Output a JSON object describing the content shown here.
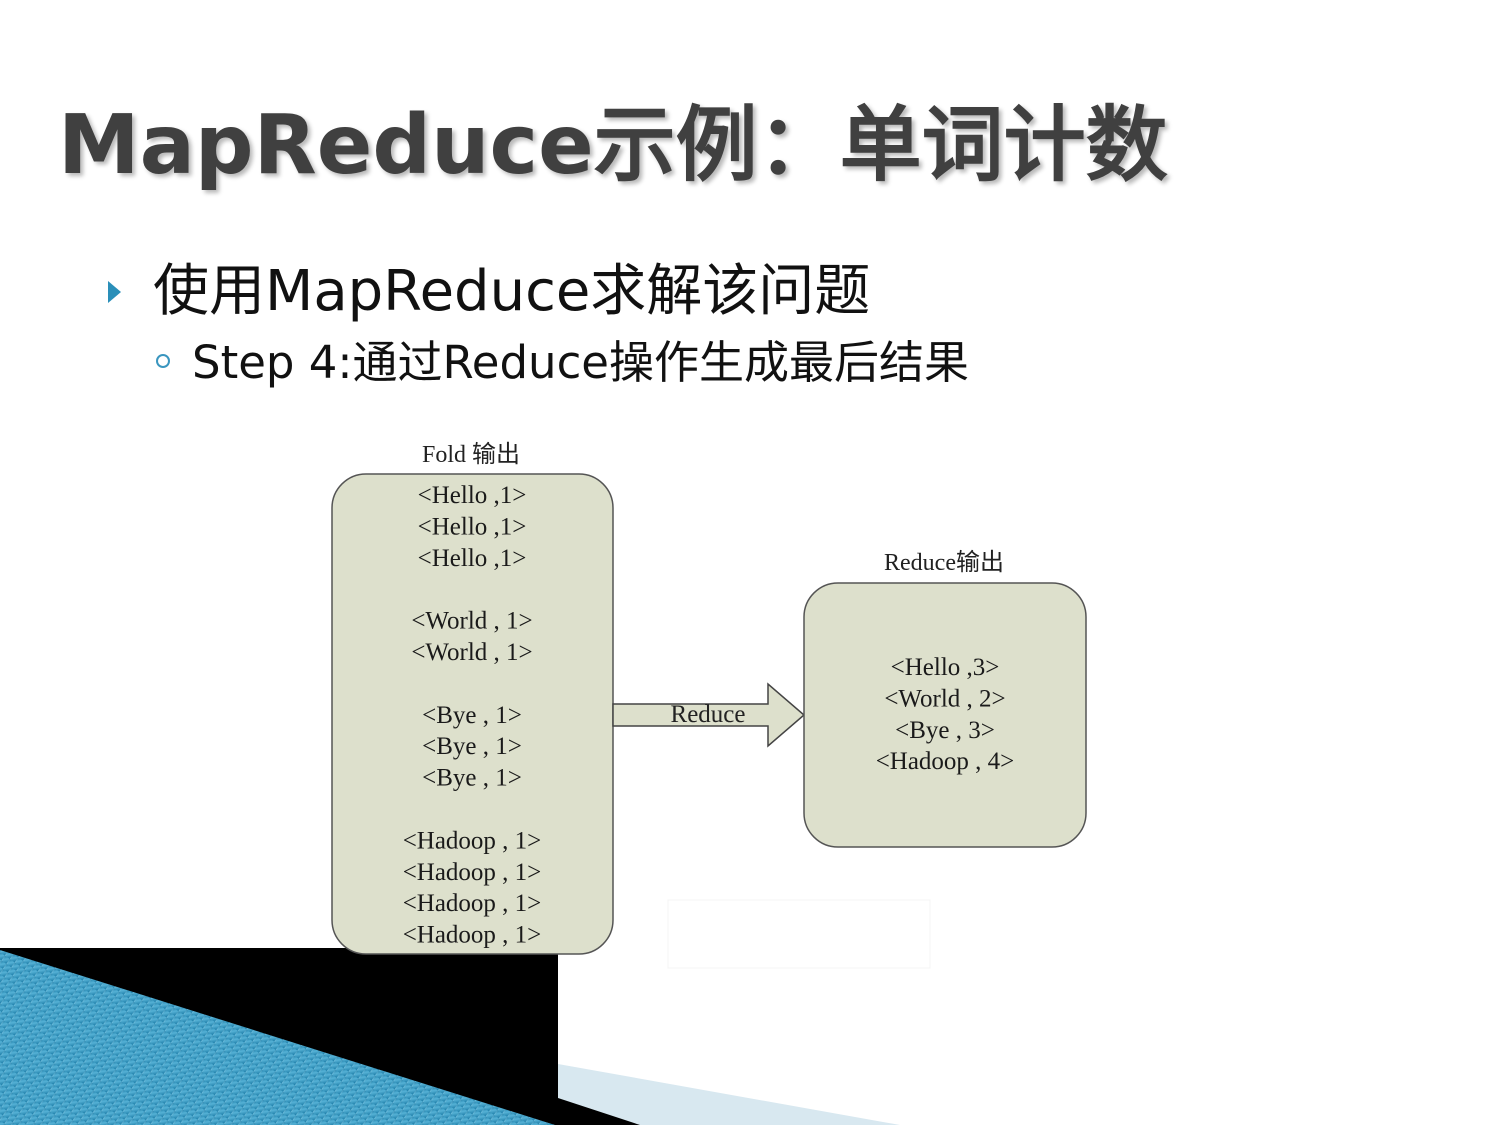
{
  "slide": {
    "title": "MapReduce示例：单词计数",
    "bullet": "使用MapReduce求解该问题",
    "sub_bullet": "Step 4:通过Reduce操作生成最后结果",
    "bullet_icon": "triangle-bullet-icon",
    "sub_bullet_icon": "hollow-circle-bullet-icon",
    "accent_color": "#2a8fb9"
  },
  "diagram": {
    "fold_box": {
      "label": "Fold 输出",
      "fill": "#dde0cc",
      "lines": [
        "<Hello ,1>",
        "<Hello ,1>",
        "<Hello ,1>",
        "",
        "<World , 1>",
        "<World , 1>",
        "",
        "<Bye , 1>",
        "<Bye , 1>",
        "<Bye , 1>",
        "",
        "<Hadoop , 1>",
        "<Hadoop , 1>",
        "<Hadoop , 1>",
        "<Hadoop , 1>"
      ]
    },
    "arrow": {
      "label": "Reduce"
    },
    "reduce_box": {
      "label": "Reduce输出",
      "fill": "#dde0cc",
      "lines": [
        "<Hello ,3>",
        "<World , 2>",
        "<Bye , 3>",
        "<Hadoop , 4>"
      ]
    }
  }
}
